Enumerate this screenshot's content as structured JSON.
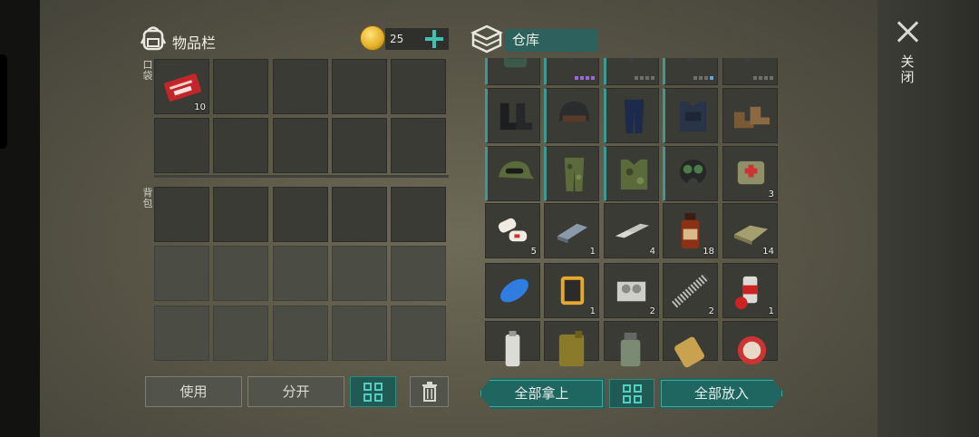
{
  "inventory": {
    "title": "物品栏",
    "coins": "25",
    "pocket_label": "口袋",
    "backpack_label": "背包",
    "pocket_items": [
      {
        "icon": "combat-hilt-coupon-icon",
        "count": "10"
      }
    ],
    "buttons": {
      "use": "使用",
      "split": "分开"
    }
  },
  "warehouse": {
    "tab_label": "仓库",
    "items": [
      {
        "icon": "military-backpack-icon",
        "count": ""
      },
      {
        "icon": "rifle-icon",
        "count": ""
      },
      {
        "icon": "rifle-icon",
        "count": ""
      },
      {
        "icon": "rifle-icon",
        "count": ""
      },
      {
        "icon": "rifle-icon",
        "count": ""
      },
      {
        "icon": "combat-boots-icon",
        "count": ""
      },
      {
        "icon": "tactical-helmet-icon",
        "count": ""
      },
      {
        "icon": "tactical-pants-icon",
        "count": ""
      },
      {
        "icon": "body-armor-vest-icon",
        "count": ""
      },
      {
        "icon": "leather-boots-icon",
        "count": ""
      },
      {
        "icon": "camo-cap-goggles-icon",
        "count": ""
      },
      {
        "icon": "camo-pants-icon",
        "count": ""
      },
      {
        "icon": "camo-vest-icon",
        "count": ""
      },
      {
        "icon": "gas-mask-icon",
        "count": ""
      },
      {
        "icon": "medical-pouch-icon",
        "count": "3"
      },
      {
        "icon": "bandages-icon",
        "count": "5"
      },
      {
        "icon": "iron-bar-icon",
        "count": "1"
      },
      {
        "icon": "aluminum-bar-icon",
        "count": "4"
      },
      {
        "icon": "medicine-bottle-icon",
        "count": "18"
      },
      {
        "icon": "cloth-icon",
        "count": "14"
      },
      {
        "icon": "fuel-tank-icon",
        "count": ""
      },
      {
        "icon": "oil-filter-icon",
        "count": "1"
      },
      {
        "icon": "engine-block-icon",
        "count": "2"
      },
      {
        "icon": "spring-icon",
        "count": "2"
      },
      {
        "icon": "spray-paint-icon",
        "count": "1"
      },
      {
        "icon": "spray-can-icon",
        "count": ""
      },
      {
        "icon": "jerrycan-icon",
        "count": ""
      },
      {
        "icon": "glue-bottle-icon",
        "count": ""
      },
      {
        "icon": "tin-can-icon",
        "count": ""
      },
      {
        "icon": "bottle-cap-icon",
        "count": ""
      }
    ],
    "buttons": {
      "take_all": "全部拿上",
      "put_all": "全部放入"
    }
  },
  "close": {
    "label": "关闭"
  },
  "colors": {
    "accent": "#3fc1b1",
    "button_teal": "#1f5a55",
    "slot": "#3a3b35"
  }
}
